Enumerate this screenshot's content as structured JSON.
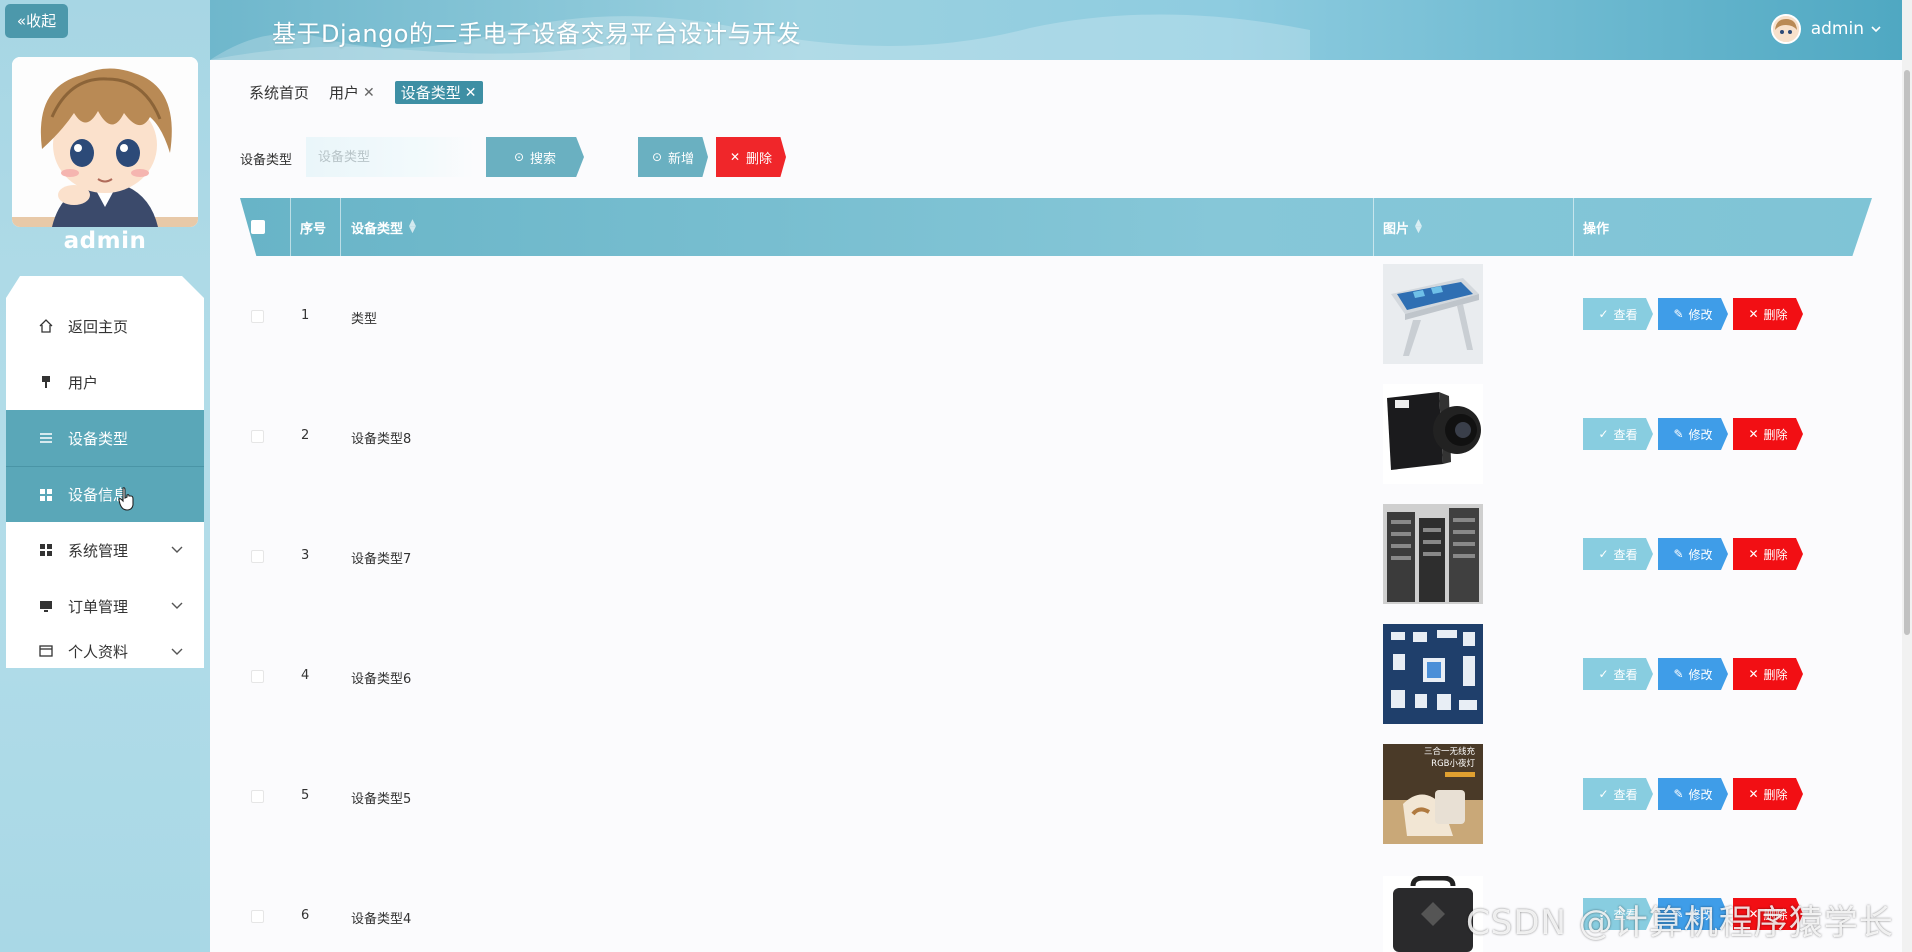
{
  "sidebar": {
    "collapse_label": "«收起",
    "username": "admin",
    "menu": [
      {
        "label": "返回主页",
        "icon": "home-icon",
        "active": false
      },
      {
        "label": "用户",
        "icon": "user-icon",
        "active": false
      },
      {
        "label": "设备类型",
        "icon": "list-icon",
        "active": true
      },
      {
        "label": "设备信息",
        "icon": "grid-icon",
        "active": true
      },
      {
        "label": "系统管理",
        "icon": "grid-icon",
        "active": false,
        "has_children": true
      },
      {
        "label": "订单管理",
        "icon": "monitor-icon",
        "active": false,
        "has_children": true
      },
      {
        "label": "个人资料",
        "icon": "profile-icon",
        "active": false,
        "has_children": true
      }
    ]
  },
  "header": {
    "title": "基于Django的二手电子设备交易平台设计与开发",
    "user": "admin"
  },
  "tags": [
    {
      "label": "系统首页",
      "closable": false,
      "active": false
    },
    {
      "label": "用户",
      "closable": true,
      "active": false
    },
    {
      "label": "设备类型",
      "closable": true,
      "active": true
    }
  ],
  "search": {
    "label": "设备类型",
    "placeholder": "设备类型",
    "search_button": "搜索",
    "add_button": "新增",
    "delete_button": "删除"
  },
  "table": {
    "columns": [
      "序号",
      "设备类型",
      "图片",
      "操作"
    ],
    "rows": [
      {
        "index": "1",
        "type": "类型",
        "image": "touch-table-kiosk"
      },
      {
        "index": "2",
        "type": "设备类型8",
        "image": "industrial-camera"
      },
      {
        "index": "3",
        "type": "设备类型7",
        "image": "server-racks"
      },
      {
        "index": "4",
        "type": "设备类型6",
        "image": "home-appliances-diagram"
      },
      {
        "index": "5",
        "type": "设备类型5",
        "image": "wireless-charger-lamp"
      },
      {
        "index": "6",
        "type": "设备类型4",
        "image": "equipment-case"
      }
    ],
    "actions": {
      "view": "查看",
      "edit": "修改",
      "delete": "删除"
    },
    "image_overlay_text": {
      "line1": "三合一无线充",
      "line2": "RGB小夜灯"
    }
  },
  "watermark": "CSDN @计算机程序猿学长",
  "colors": {
    "sidebar_bg": "#a7d6e4",
    "active_menu": "#5aa7b8",
    "teal_button": "#6ab0c1",
    "danger": "#f0262a",
    "edit_blue": "#3f9de8",
    "view_blue": "#88cde0"
  }
}
